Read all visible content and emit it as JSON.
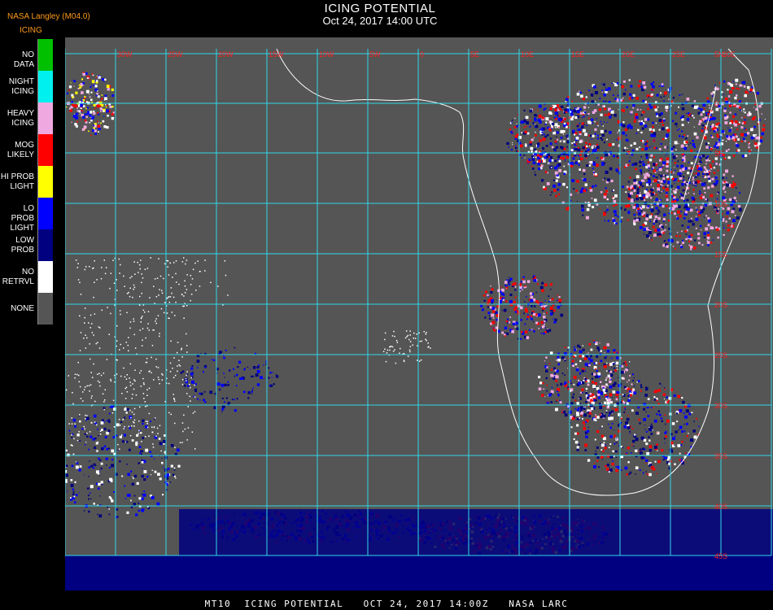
{
  "header": {
    "title": "ICING POTENTIAL",
    "subtitle": "Oct 24, 2017 14:00 UTC",
    "source": "NASA Langley (M04.0)",
    "legend_title": "ICING"
  },
  "legend": {
    "items": [
      {
        "label": "NO DATA",
        "color": "#00c000"
      },
      {
        "label": "NIGHT\nICING",
        "color": "#00f0f0"
      },
      {
        "label": "HEAVY\nICING",
        "color": "#f0a8e0"
      },
      {
        "label": "MOG\nLIKELY",
        "color": "#ff0000"
      },
      {
        "label": "HI PROB\nLIGHT",
        "color": "#ffff00"
      },
      {
        "label": "LO PROB\nLIGHT",
        "color": "#0000ff"
      },
      {
        "label": "LOW\nPROB",
        "color": "#000080"
      },
      {
        "label": "NO\nRETRVL",
        "color": "#ffffff"
      },
      {
        "label": "NONE",
        "color": "#555555"
      }
    ]
  },
  "map": {
    "lon_labels": [
      "35W",
      "30W",
      "25W",
      "20W",
      "15W",
      "10W",
      "5W",
      "0",
      "5E",
      "10E",
      "15E",
      "20E",
      "25E",
      "30E",
      "35E"
    ],
    "lat_labels": [
      "5N",
      "0",
      "5S",
      "10S",
      "15S",
      "20S",
      "25S",
      "30S",
      "35S",
      "40S",
      "45S",
      "50S"
    ],
    "grid_color": "#30d8e8",
    "coast_color": "#ffffff",
    "label_color": "#ff2020",
    "background_color": "#555555"
  },
  "footer": {
    "text": "MT10  ICING POTENTIAL   OCT 24, 2017 14:00Z   NASA LARC"
  }
}
